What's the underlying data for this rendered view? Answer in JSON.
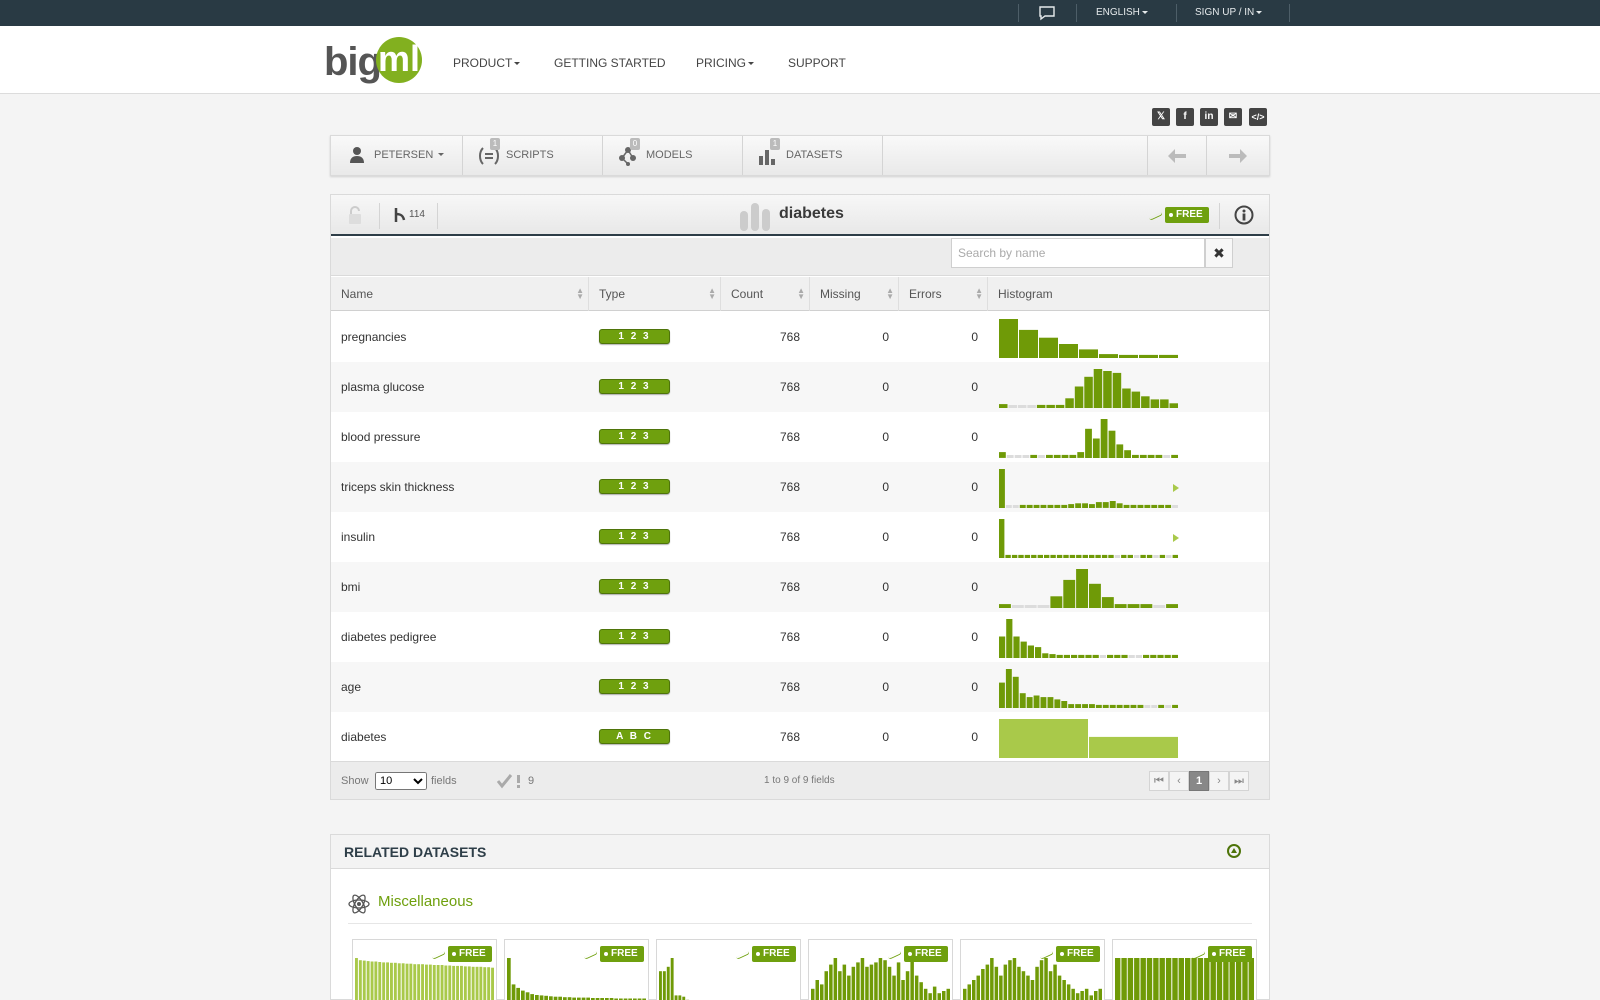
{
  "topbar": {
    "chat_icon": "chat-bubble-icon",
    "language": "ENGLISH",
    "signup": "SIGN UP / IN"
  },
  "nav": {
    "product": "PRODUCT",
    "getting_started": "GETTING STARTED",
    "pricing": "PRICING",
    "support": "SUPPORT"
  },
  "logo": {
    "part1": "big",
    "part2": "ml"
  },
  "share": [
    "x-icon",
    "facebook-icon",
    "linkedin-icon",
    "email-icon",
    "embed-code-icon"
  ],
  "resource_tabs": {
    "user": "PETERSEN",
    "scripts": {
      "label": "SCRIPTS",
      "count": "1"
    },
    "models": {
      "label": "MODELS",
      "count": "0"
    },
    "datasets": {
      "label": "DATASETS",
      "count": "1"
    }
  },
  "dataset": {
    "name": "diabetes",
    "clone_count": "114",
    "price_tag": "FREE",
    "search_placeholder": "Search by name",
    "columns": [
      "Name",
      "Type",
      "Count",
      "Missing",
      "Errors",
      "Histogram"
    ],
    "fields": [
      {
        "name": "pregnancies",
        "type": "1 2 3",
        "count": "768",
        "missing": "0",
        "errors": "0",
        "hist": [
          100,
          72,
          52,
          36,
          22,
          10,
          8,
          8,
          8
        ]
      },
      {
        "name": "plasma glucose",
        "type": "1 2 3",
        "count": "768",
        "missing": "0",
        "errors": "0",
        "hist": [
          10,
          5,
          5,
          5,
          8,
          8,
          8,
          25,
          55,
          80,
          100,
          95,
          90,
          50,
          42,
          30,
          22,
          22,
          12
        ]
      },
      {
        "name": "blood pressure",
        "type": "1 2 3",
        "count": "768",
        "missing": "0",
        "errors": "0",
        "hist": [
          15,
          5,
          5,
          5,
          8,
          5,
          8,
          8,
          8,
          8,
          15,
          75,
          50,
          100,
          70,
          35,
          20,
          8,
          8,
          8,
          8,
          5,
          8
        ]
      },
      {
        "name": "triceps skin thickness",
        "type": "1 2 3",
        "count": "768",
        "missing": "0",
        "errors": "0",
        "hist": [
          100,
          5,
          5,
          8,
          8,
          8,
          8,
          8,
          8,
          8,
          10,
          12,
          12,
          10,
          15,
          15,
          18,
          12,
          8,
          8,
          8,
          8,
          8,
          8,
          8,
          5
        ]
      },
      {
        "name": "insulin",
        "type": "1 2 3",
        "count": "768",
        "missing": "0",
        "errors": "0",
        "hist": [
          100,
          8,
          8,
          8,
          8,
          8,
          8,
          8,
          8,
          8,
          8,
          8,
          8,
          8,
          8,
          8,
          8,
          8,
          5,
          8,
          8,
          5,
          8,
          8,
          5,
          8,
          5,
          8
        ]
      },
      {
        "name": "bmi",
        "type": "1 2 3",
        "count": "768",
        "missing": "0",
        "errors": "0",
        "hist": [
          10,
          5,
          5,
          5,
          30,
          72,
          100,
          62,
          28,
          10,
          10,
          10,
          5,
          10
        ]
      },
      {
        "name": "diabetes pedigree",
        "type": "1 2 3",
        "count": "768",
        "missing": "0",
        "errors": "0",
        "hist": [
          55,
          100,
          55,
          42,
          32,
          28,
          12,
          10,
          8,
          8,
          8,
          8,
          8,
          8,
          5,
          8,
          8,
          8,
          5,
          5,
          8,
          8,
          8,
          8,
          8
        ]
      },
      {
        "name": "age",
        "type": "1 2 3",
        "count": "768",
        "missing": "0",
        "errors": "0",
        "hist": [
          65,
          100,
          80,
          38,
          28,
          32,
          28,
          28,
          22,
          18,
          10,
          10,
          10,
          10,
          8,
          8,
          8,
          8,
          8,
          8,
          8,
          5,
          5,
          8,
          5,
          8
        ]
      },
      {
        "name": "diabetes",
        "type": "A B C",
        "count": "768",
        "missing": "0",
        "errors": "0",
        "hist": [
          100,
          54
        ],
        "categorical": true
      }
    ],
    "footer": {
      "show": "Show",
      "page_size": "10",
      "fields_label": "fields",
      "check_count": "9",
      "range_text": "1 to 9 of 9 fields",
      "page": "1"
    }
  },
  "related": {
    "title": "RELATED DATASETS",
    "category": "Miscellaneous",
    "thumbs": [
      {
        "tag": "FREE",
        "hist": [
          100,
          95,
          94,
          93,
          92,
          92,
          91,
          90,
          90,
          89,
          89,
          88,
          88,
          87,
          87,
          86,
          86,
          86,
          85,
          85,
          84,
          84,
          84,
          83,
          83,
          82,
          82,
          82,
          81,
          81,
          80,
          80,
          80,
          79,
          79,
          78
        ]
      },
      {
        "tag": "FREE",
        "hist": [
          100,
          40,
          32,
          26,
          22,
          18,
          16,
          15,
          14,
          13,
          12,
          12,
          11,
          11,
          10,
          10,
          10,
          10,
          9,
          9,
          9,
          9,
          9,
          8,
          8,
          8,
          8,
          8,
          8,
          8
        ]
      },
      {
        "tag": "FREE",
        "hist": [
          70,
          70,
          80,
          100,
          15,
          15,
          12,
          5,
          4,
          4,
          4,
          3,
          3,
          3,
          3,
          3,
          3,
          3,
          3,
          3,
          3,
          3,
          3,
          3,
          3,
          3,
          3,
          3,
          3,
          3,
          3,
          3,
          3,
          3,
          3,
          3
        ]
      },
      {
        "tag": "FREE",
        "hist": [
          30,
          50,
          40,
          70,
          85,
          100,
          70,
          85,
          60,
          80,
          90,
          100,
          80,
          85,
          90,
          100,
          95,
          80,
          60,
          90,
          50,
          70,
          100,
          60,
          45,
          30,
          20,
          35,
          20,
          25,
          30
        ]
      },
      {
        "tag": "FREE",
        "hist": [
          30,
          40,
          50,
          60,
          75,
          85,
          100,
          80,
          60,
          85,
          95,
          100,
          80,
          70,
          60,
          50,
          80,
          95,
          100,
          70,
          85,
          60,
          50,
          40,
          30,
          20,
          25,
          30,
          15,
          25,
          30
        ]
      },
      {
        "tag": "FREE",
        "hist": [
          100,
          100,
          100,
          100,
          100,
          100,
          100,
          100,
          100,
          100,
          100,
          100,
          100,
          100,
          100,
          100,
          100,
          100,
          100,
          100,
          100,
          100
        ]
      }
    ]
  },
  "colors": {
    "accent": "#6fa00e",
    "dark": "#293a44",
    "hist_bar": "#6f9a07",
    "hist_light": "#a9c94a",
    "empty": "#dcdcdc"
  }
}
